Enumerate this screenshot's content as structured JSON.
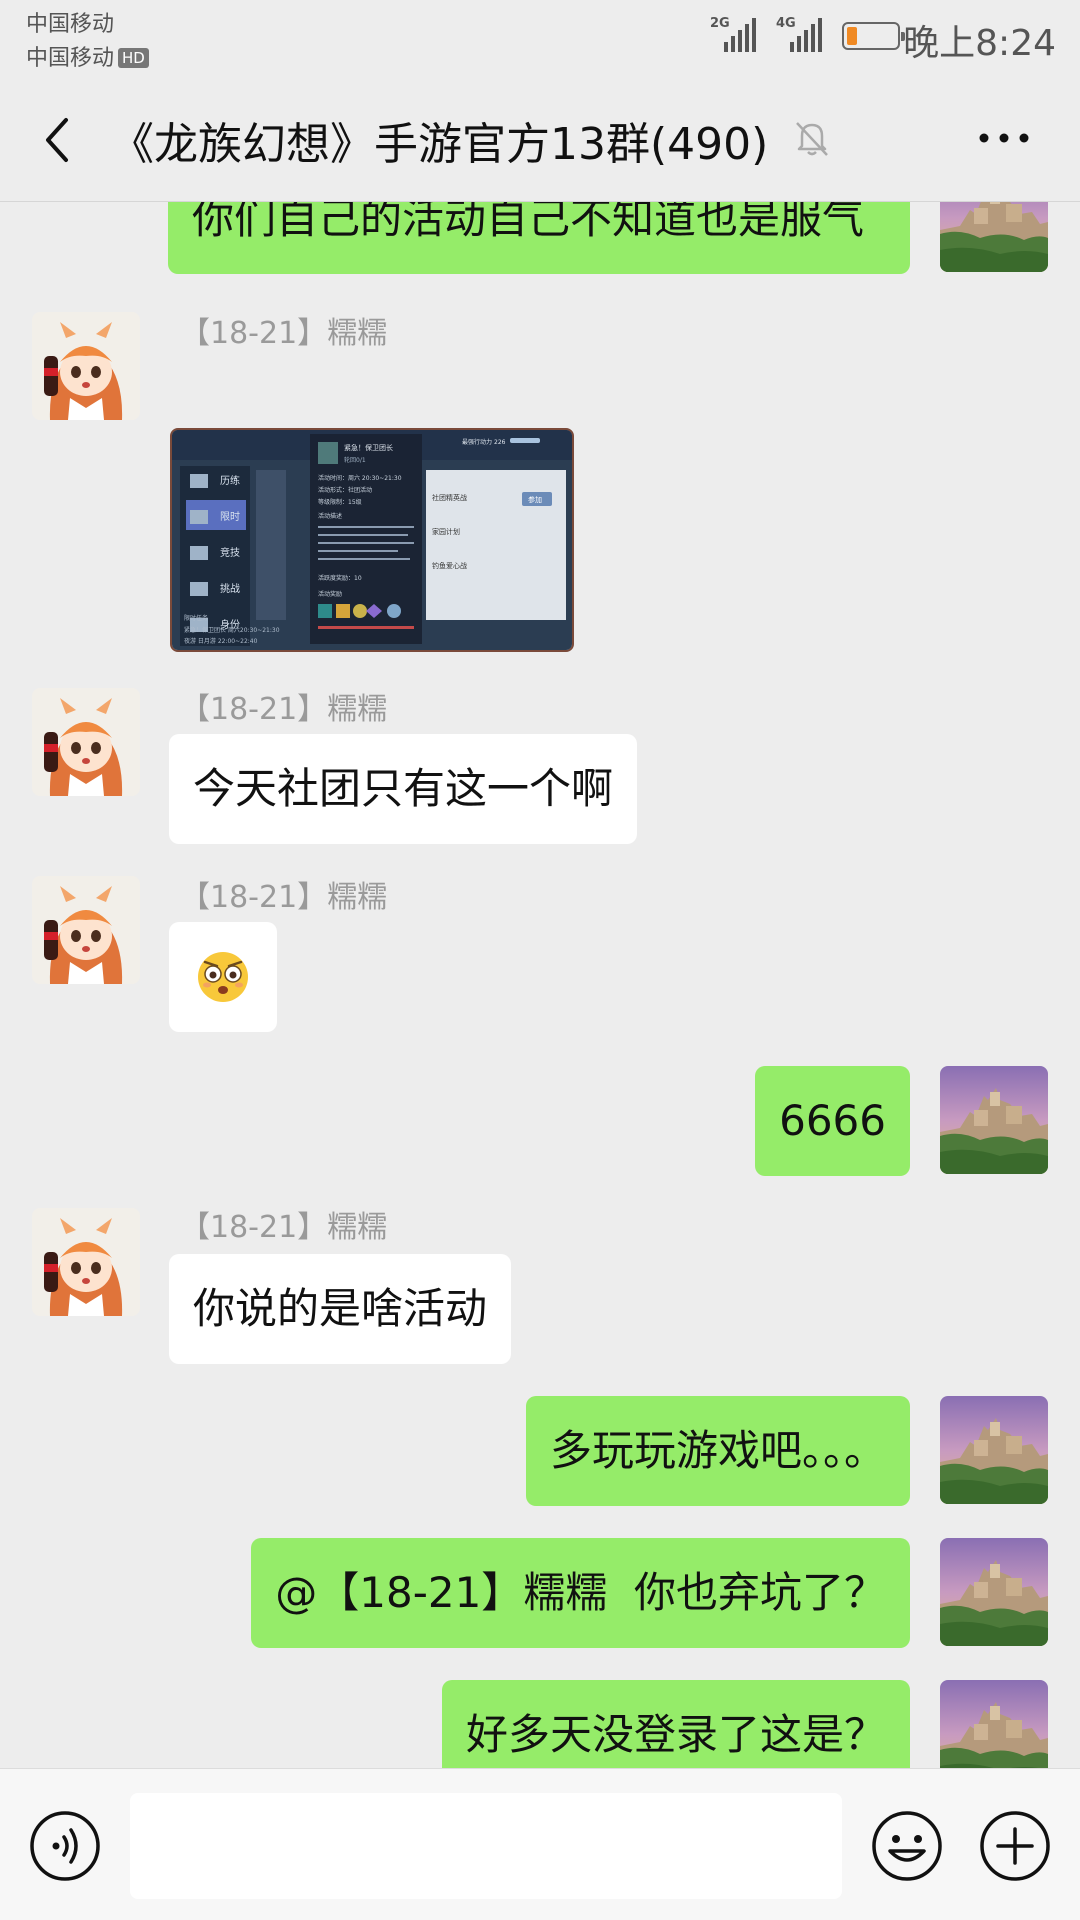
{
  "status_bar": {
    "carrier_1": "中国移动",
    "carrier_2": "中国移动",
    "carrier_2_badge": "HD",
    "signal_1_tag": "2G",
    "signal_2_tag": "4G",
    "battery_level": 0.2,
    "battery_color": "#f08a24",
    "time": "晚上8:24"
  },
  "header": {
    "title": "《龙族幻想》手游官方13群(490)",
    "icons": [
      "back-arrow-icon",
      "mute-bell-icon",
      "more-dots-icon"
    ]
  },
  "messages": [
    {
      "side": "out",
      "type": "text",
      "text": "你们自己的活动自己不知道也是服气"
    },
    {
      "side": "in",
      "type": "image",
      "sender": "【18-21】糯糯",
      "image": "game-screenshot"
    },
    {
      "side": "in",
      "type": "text",
      "sender": "【18-21】糯糯",
      "text": "今天社团只有这一个啊"
    },
    {
      "side": "in",
      "type": "emoji",
      "sender": "【18-21】糯糯",
      "emoji": "😳"
    },
    {
      "side": "out",
      "type": "text",
      "text": "6666"
    },
    {
      "side": "in",
      "type": "text",
      "sender": "【18-21】糯糯",
      "text": "你说的是啥活动"
    },
    {
      "side": "out",
      "type": "text",
      "text": "多玩玩游戏吧。。。"
    },
    {
      "side": "out",
      "type": "text",
      "text": "@【18-21】糯糯  你也弃坑了？"
    },
    {
      "side": "out",
      "type": "text",
      "text": "好多天没登录了这是？"
    }
  ],
  "game_screenshot": {
    "menu": [
      "历练",
      "限时",
      "竞技",
      "挑战",
      "身份"
    ],
    "popup_title": "紧急！保卫团长",
    "popup_sub": "轮回0/1",
    "popup_rows": [
      "活动时间：周六 20:30~21:30",
      "活动形式：社团活动",
      "等级限制：15级",
      "活动描述",
      "活跃度奖励：10",
      "活动奖励"
    ],
    "right_items": [
      "社团精英战",
      "家园计划",
      "钓鱼爱心战"
    ],
    "join_label": "参加",
    "top_label": "最强行动力",
    "top_value": "226",
    "bottom_lines": [
      "限时任务",
      "紧急！保卫团长 周六20:30~21:30",
      "夜游 日月游 22:00~22:40"
    ]
  },
  "input_bar": {
    "placeholder": "",
    "icons": [
      "voice-icon",
      "emoji-icon",
      "plus-icon"
    ]
  },
  "colors": {
    "background": "#ededed",
    "bubble_out": "#95ec69",
    "bubble_in": "#ffffff"
  }
}
